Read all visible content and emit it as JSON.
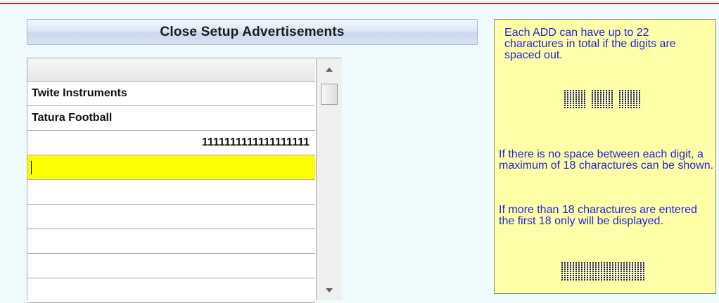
{
  "header": {
    "title": "Close Setup Advertisements"
  },
  "ad_list": {
    "rows": [
      {
        "value": "Twite Instruments",
        "align": "left"
      },
      {
        "value": "Tatura Football",
        "align": "left"
      },
      {
        "value": "1111111111111111111",
        "align": "right"
      },
      {
        "value": "",
        "align": "left",
        "selected": true
      },
      {
        "value": "",
        "align": "left"
      },
      {
        "value": "",
        "align": "left"
      },
      {
        "value": "",
        "align": "left"
      },
      {
        "value": "",
        "align": "left"
      },
      {
        "value": "",
        "align": "left"
      }
    ]
  },
  "info": {
    "p1": "Each ADD can have up to 22 charactures in total if the digits are spaced out.",
    "p2": "If there is no space between each digit, a maximum of 18 charactures can be shown.",
    "p3": "If more than 18 charactures are entered the first 18 only will be displayed."
  },
  "colors": {
    "background": "#f0fbfd",
    "selected_row": "#fdfd04",
    "info_bg": "#ffffa8",
    "info_text": "#2222dd",
    "top_line": "#d9201f"
  },
  "icons": {
    "scroll_up": "scroll-up-arrow-icon",
    "scroll_down": "scroll-down-arrow-icon"
  }
}
